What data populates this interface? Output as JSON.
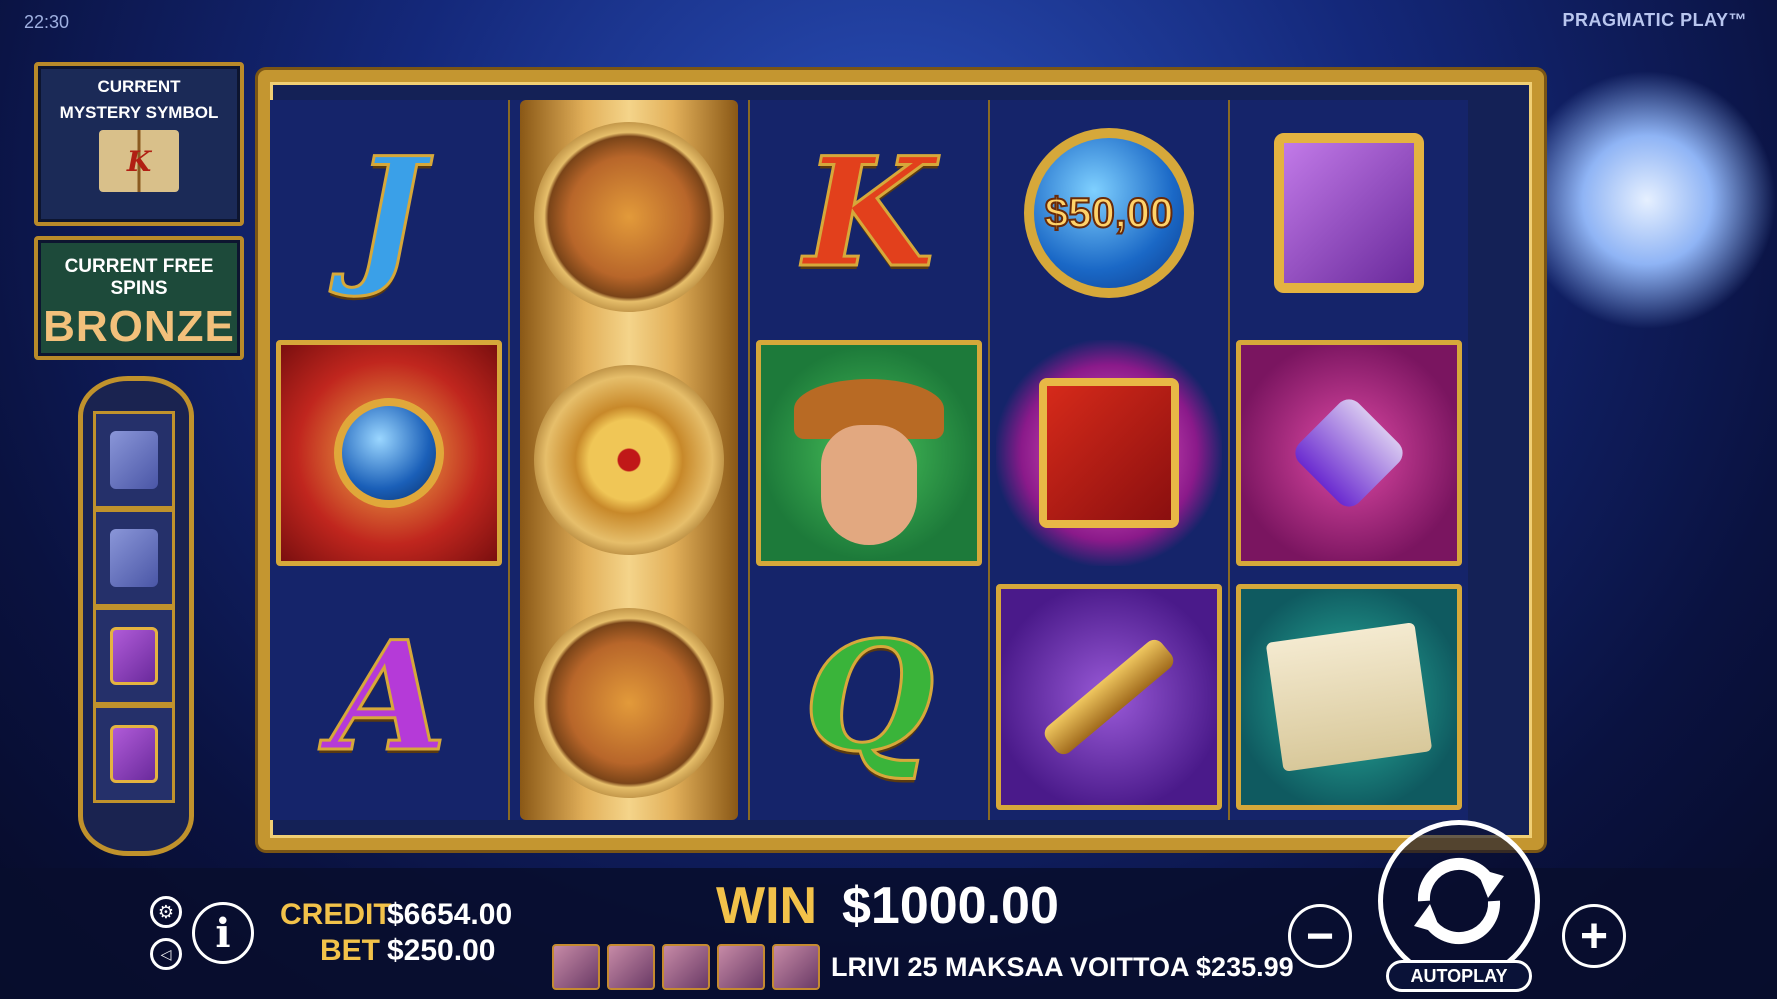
{
  "status_bar": {
    "time": "22:30"
  },
  "brand": "PRAGMATIC PLAY™",
  "mystery_panel": {
    "title_line1": "CURRENT",
    "title_line2": "MYSTERY SYMBOL",
    "symbol": "K"
  },
  "free_spins_panel": {
    "title": "CURRENT FREE SPINS",
    "level": "BRONZE"
  },
  "book_tower": [
    "book-grey",
    "book-grey",
    "book-gold",
    "book-gold"
  ],
  "reels": [
    [
      "J",
      "armillary-sphere",
      "A"
    ],
    [
      "compass",
      "compass",
      "compass"
    ],
    [
      "K",
      "explorer",
      "Q"
    ],
    [
      "$50,00",
      "mystery-book",
      "telescope"
    ],
    [
      "treasure-book",
      "quill-ink",
      "map-scroll"
    ]
  ],
  "reel_letters": {
    "r1a": "J",
    "r1c": "A",
    "r3a": "K",
    "r3c": "Q"
  },
  "coin_value": "$50,00",
  "footer": {
    "credit_label": "CREDIT",
    "credit_value": "$6654.00",
    "bet_label": "BET",
    "bet_value": "$250.00",
    "win_label": "WIN",
    "win_value": "$1000.00",
    "line_win_text": "LRIVI 25 MAKSAA VOITTOA $235.99",
    "autoplay_label": "AUTOPLAY",
    "minus": "−",
    "plus": "+",
    "info": "i"
  },
  "colors": {
    "gold": "#c49630",
    "win_yellow": "#f2c24a",
    "bronze": "#f2c07b"
  }
}
